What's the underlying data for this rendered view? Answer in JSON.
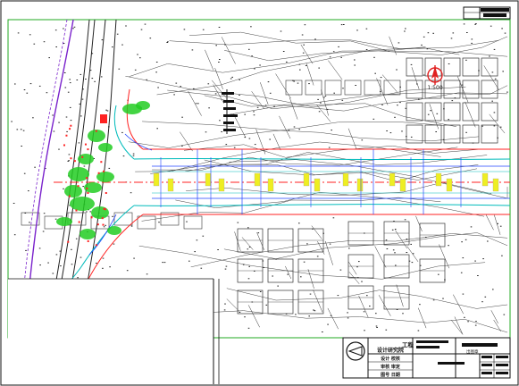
{
  "drawing": {
    "scale_label": "1:500",
    "colors": {
      "frame": "#22aa22",
      "road_edge": "#ff2222",
      "centerline": "#ff2222",
      "lane_line": "#00bbbb",
      "buildings": "#333333",
      "highway": "#7a22cc",
      "vegetation": "#22cc22",
      "markers": "#eeee22",
      "chainage": "#2244ff"
    }
  },
  "title_block": {
    "project_label": "工程",
    "institute_name": "设计研究院",
    "row1": "设计 校核",
    "row2": "审核 审定",
    "row3": "图号 日期",
    "stamp_label": "出图章"
  }
}
